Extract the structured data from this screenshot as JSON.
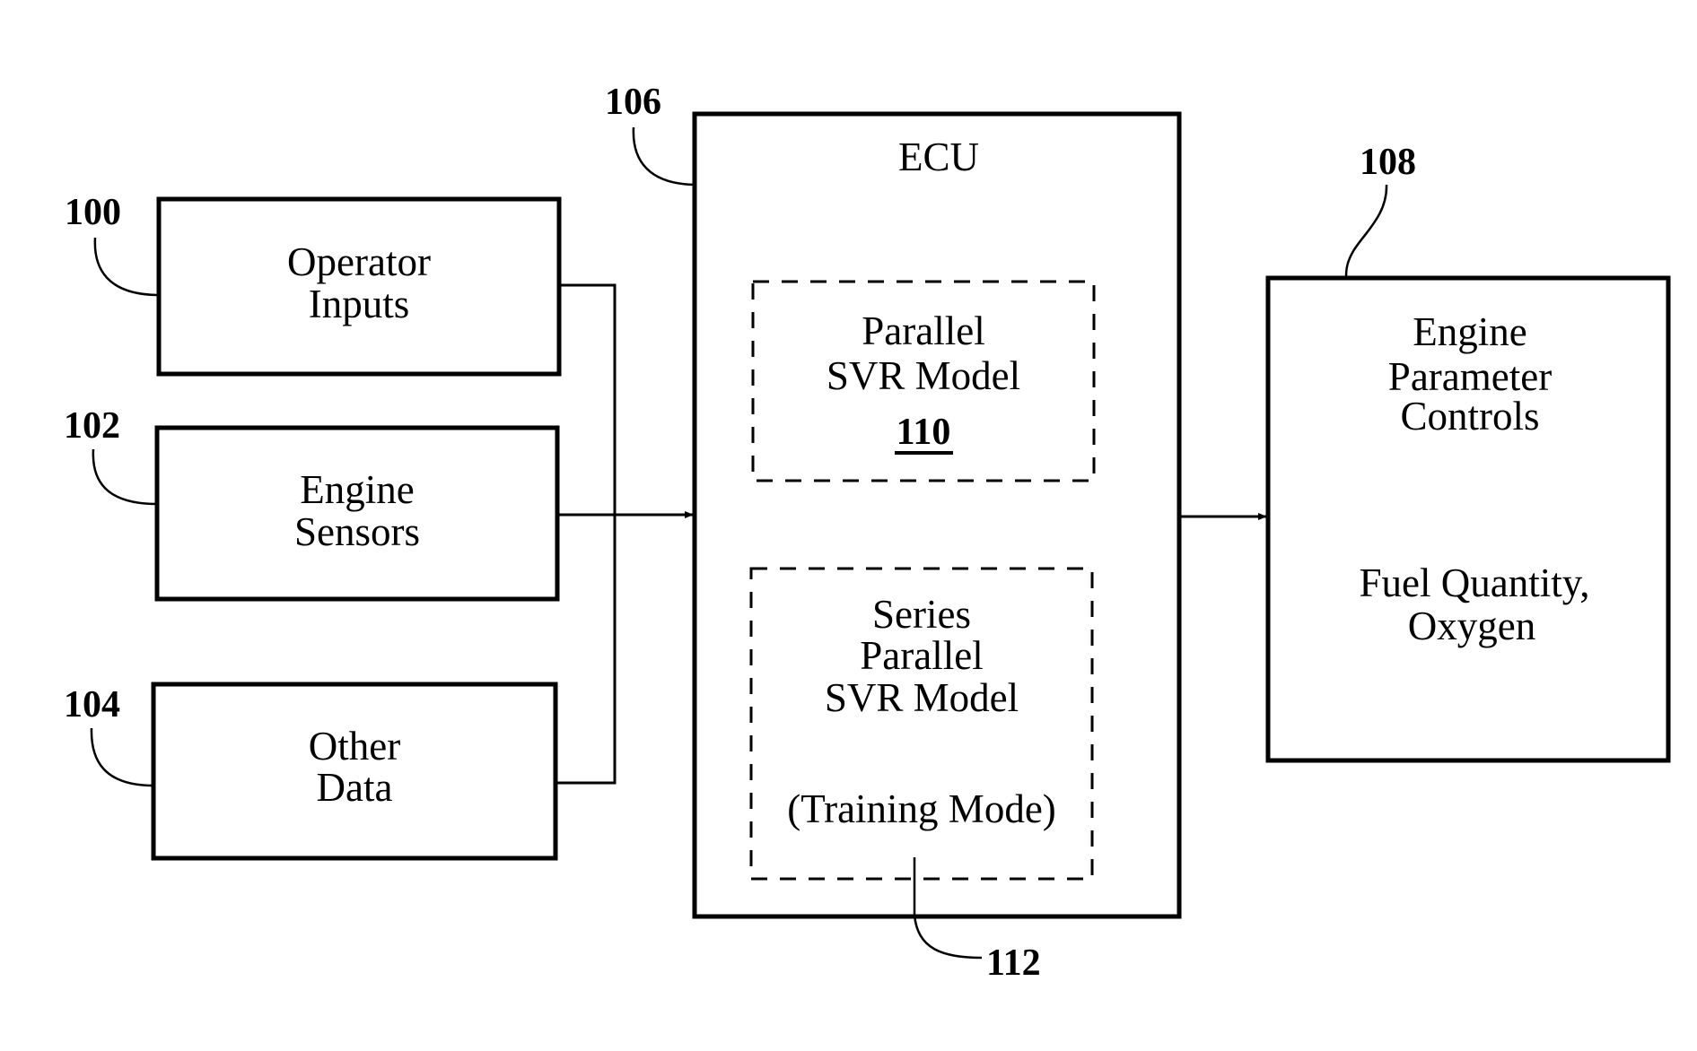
{
  "figure": {
    "blocks": {
      "operator_inputs": {
        "ref": "100",
        "lines": [
          "Operator",
          "Inputs"
        ]
      },
      "engine_sensors": {
        "ref": "102",
        "lines": [
          "Engine",
          "Sensors"
        ]
      },
      "other_data": {
        "ref": "104",
        "lines": [
          "Other",
          "Data"
        ]
      },
      "ecu": {
        "ref": "106",
        "title": "ECU"
      },
      "engine_parameter_controls": {
        "ref": "108",
        "lines": [
          "Engine",
          "Parameter",
          "Controls"
        ],
        "detail_lines": [
          "Fuel Quantity,",
          "Oxygen"
        ]
      },
      "parallel_svr_model": {
        "ref": "110",
        "lines": [
          "Parallel",
          "SVR Model"
        ]
      },
      "series_parallel_svr_model": {
        "ref": "112",
        "lines": [
          "Series",
          "Parallel",
          "SVR Model"
        ],
        "mode": "(Training Mode)"
      }
    },
    "connections": [
      {
        "from": "operator_inputs",
        "to": "ecu"
      },
      {
        "from": "engine_sensors",
        "to": "ecu"
      },
      {
        "from": "other_data",
        "to": "ecu"
      },
      {
        "from": "ecu",
        "to": "engine_parameter_controls"
      }
    ]
  }
}
